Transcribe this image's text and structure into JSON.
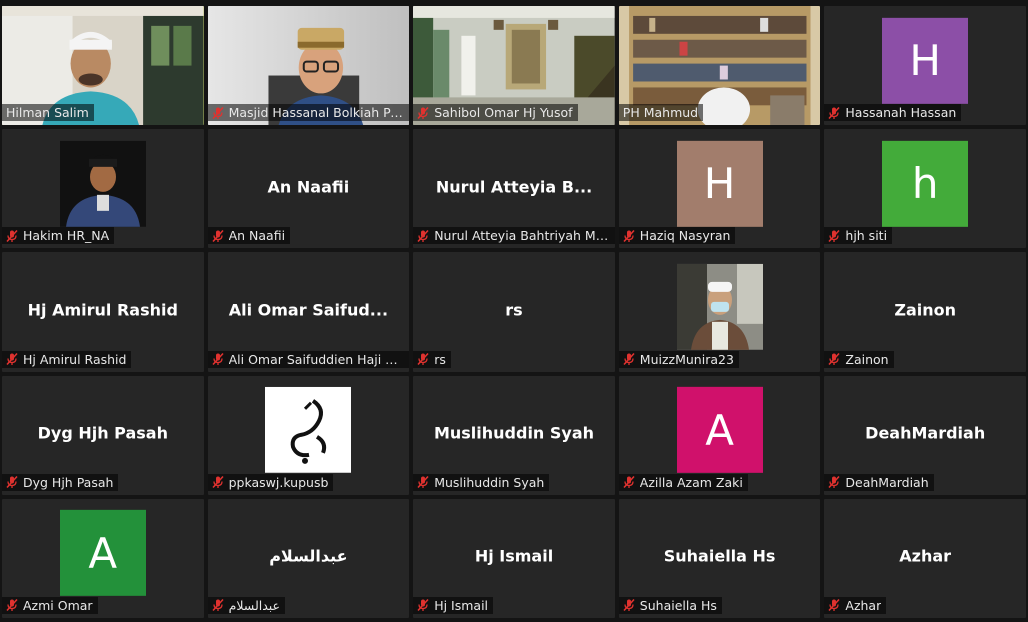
{
  "colors": {
    "active_border": "#d8e25a",
    "mic_muted": "#e0322f",
    "tile_bg": "#262626"
  },
  "tiles": [
    {
      "name": "Hilman Salim",
      "muted": false,
      "kind": "video",
      "scene": "man-kopiah",
      "active": true
    },
    {
      "name": "Masjid Hassanal Bolkiah Pe...",
      "muted": true,
      "kind": "video",
      "scene": "man-glasses"
    },
    {
      "name": "Sahibol Omar Hj Yusof",
      "muted": true,
      "kind": "video",
      "scene": "mosque-interior"
    },
    {
      "name": "PH Mahmud",
      "muted": false,
      "kind": "video",
      "scene": "bookshelf"
    },
    {
      "name": "Hassanah Hassan",
      "muted": true,
      "kind": "avatar",
      "letter": "H",
      "color": "#8c4fa7"
    },
    {
      "name": "Hakim HR_NA",
      "muted": true,
      "kind": "picture",
      "scene": "portrait"
    },
    {
      "name": "An Naafii",
      "muted": true,
      "kind": "text",
      "display": "An Naafii"
    },
    {
      "name": "Nurul Atteyia Bahtriyah Md...",
      "muted": true,
      "kind": "text",
      "display": "Nurul Atteyia B..."
    },
    {
      "name": "Haziq Nasyran",
      "muted": true,
      "kind": "avatar",
      "letter": "H",
      "color": "#a27d6c"
    },
    {
      "name": "hjh siti",
      "muted": true,
      "kind": "avatar",
      "letter": "h",
      "color": "#43ab3a"
    },
    {
      "name": "Hj Amirul Rashid",
      "muted": true,
      "kind": "text",
      "display": "Hj Amirul Rashid"
    },
    {
      "name": "Ali Omar Saifuddien Haji Al...",
      "muted": true,
      "kind": "text",
      "display": "Ali Omar Saifud..."
    },
    {
      "name": "rs",
      "muted": true,
      "kind": "text",
      "display": "rs"
    },
    {
      "name": "MuizzMunira23",
      "muted": true,
      "kind": "picture",
      "scene": "masked-man"
    },
    {
      "name": "Zainon",
      "muted": true,
      "kind": "text",
      "display": "Zainon"
    },
    {
      "name": "Dyg Hjh Pasah",
      "muted": true,
      "kind": "text",
      "display": "Dyg Hjh Pasah"
    },
    {
      "name": "ppkaswj.kupusb",
      "muted": true,
      "kind": "picture",
      "scene": "calligraphy"
    },
    {
      "name": "Muslihuddin Syah",
      "muted": true,
      "kind": "text",
      "display": "Muslihuddin Syah"
    },
    {
      "name": "Azilla Azam Zaki",
      "muted": true,
      "kind": "avatar",
      "letter": "A",
      "color": "#d0116b"
    },
    {
      "name": "DeahMardiah",
      "muted": true,
      "kind": "text",
      "display": "DeahMardiah"
    },
    {
      "name": "Azmi Omar",
      "muted": true,
      "kind": "avatar",
      "letter": "A",
      "color": "#23913a"
    },
    {
      "name": "عبدالسلام",
      "muted": true,
      "kind": "text",
      "display": "عبدالسلام"
    },
    {
      "name": "Hj Ismail",
      "muted": true,
      "kind": "text",
      "display": "Hj Ismail"
    },
    {
      "name": "Suhaiella Hs",
      "muted": true,
      "kind": "text",
      "display": "Suhaiella Hs"
    },
    {
      "name": "Azhar",
      "muted": true,
      "kind": "text",
      "display": "Azhar"
    }
  ]
}
